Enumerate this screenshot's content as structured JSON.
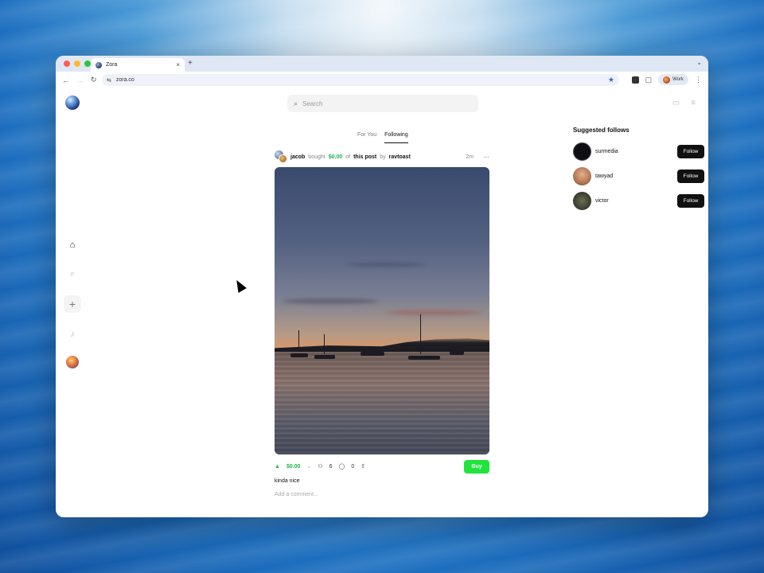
{
  "browser": {
    "tab_title": "Zora",
    "tab_close": "×",
    "new_tab": "+",
    "url": "zora.co",
    "profile_label": "Work",
    "chevron": "⌄"
  },
  "app": {
    "search_placeholder": "Search"
  },
  "feed_tabs": [
    {
      "label": "For You",
      "active": false
    },
    {
      "label": "Following",
      "active": true
    }
  ],
  "post": {
    "user": "jacob",
    "action": "bought",
    "amount": "$0.00",
    "of_text": "of",
    "target": "this post",
    "by_text": "by",
    "author": "ravtoast",
    "time": "2m",
    "more": "···",
    "price": "$0.00",
    "holders": "6",
    "comments": "0",
    "buy_label": "Buy",
    "caption": "kinda nice",
    "comment_placeholder": "Add a comment..."
  },
  "suggested": {
    "title": "Suggested follows",
    "users": [
      {
        "name": "surmedia",
        "button": "Follow",
        "color": "#0f0f12"
      },
      {
        "name": "tawyad",
        "button": "Follow",
        "color": "#c7906d"
      },
      {
        "name": "victor",
        "button": "Follow",
        "color": "#4a4b3a"
      }
    ]
  },
  "colors": {
    "accent_green": "#1fe43b",
    "text_green": "#22b14c",
    "follow_button": "#111111"
  }
}
